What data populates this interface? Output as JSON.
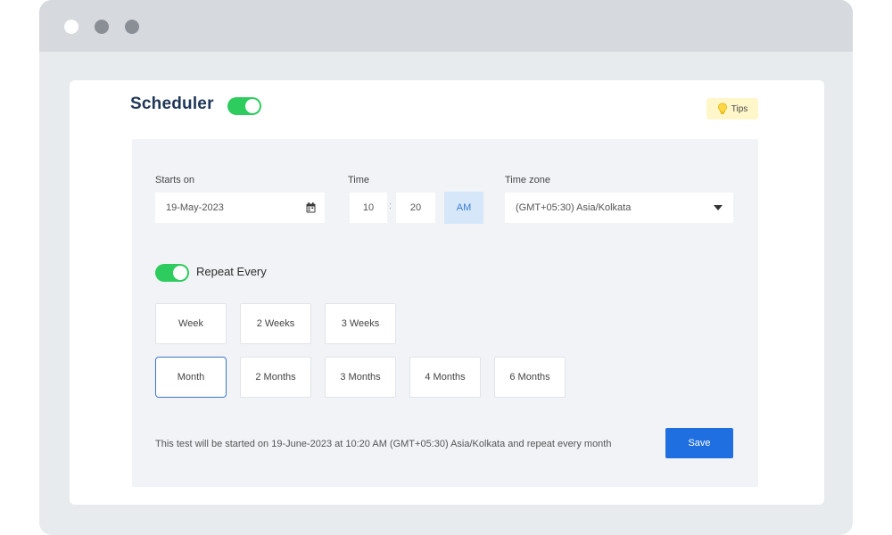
{
  "window": {
    "controls": [
      "close",
      "minimize",
      "maximize"
    ]
  },
  "scheduler": {
    "title": "Scheduler",
    "enabled": true,
    "tips_label": "Tips",
    "starts_on": {
      "label": "Starts on",
      "value": "19-May-2023"
    },
    "time": {
      "label": "Time",
      "hour": "10",
      "separator": ":",
      "minute": "20",
      "meridiem": "AM"
    },
    "timezone": {
      "label": "Time zone",
      "value": "(GMT+05:30) Asia/Kolkata"
    },
    "repeat": {
      "enabled": true,
      "label": "Repeat Every",
      "row1": [
        "Week",
        "2 Weeks",
        "3 Weeks"
      ],
      "row2": [
        "Month",
        "2 Months",
        "3 Months",
        "4 Months",
        "6 Months"
      ],
      "selected": "Month"
    },
    "summary": "This test will be started on 19-June-2023 at 10:20 AM (GMT+05:30) Asia/Kolkata and repeat every month",
    "save_label": "Save"
  },
  "colors": {
    "accent": "#1f6fe0",
    "toggle_on": "#2ecc5e",
    "title": "#1f3658",
    "tips_bg": "#fff6c9"
  },
  "icons": [
    "lightbulb-icon",
    "calendar-icon",
    "caret-down-icon"
  ]
}
